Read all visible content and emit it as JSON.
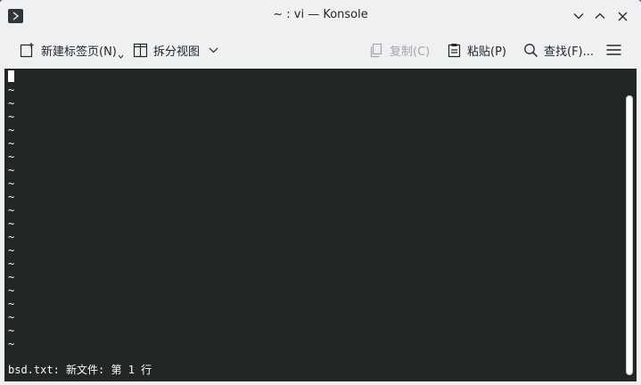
{
  "window": {
    "title": "~ : vi — Konsole",
    "app_icon": "terminal-prompt-icon"
  },
  "window_controls": {
    "minimize_icon": "chevron-down-icon",
    "maximize_icon": "chevron-up-icon",
    "close_icon": "close-icon"
  },
  "toolbar": {
    "new_tab_label": "新建标签页(N)",
    "split_view_label": "拆分视图",
    "copy_label": "复制(C)",
    "paste_label": "粘贴(P)",
    "find_label": "查找(F)...",
    "menu_icon": "hamburger-menu-icon"
  },
  "terminal": {
    "tilde": "~",
    "empty_line_count": 20,
    "status_line": "bsd.txt: 新文件: 第 1 行",
    "colors": {
      "background": "#232627",
      "foreground": "#fcfcfc"
    }
  }
}
